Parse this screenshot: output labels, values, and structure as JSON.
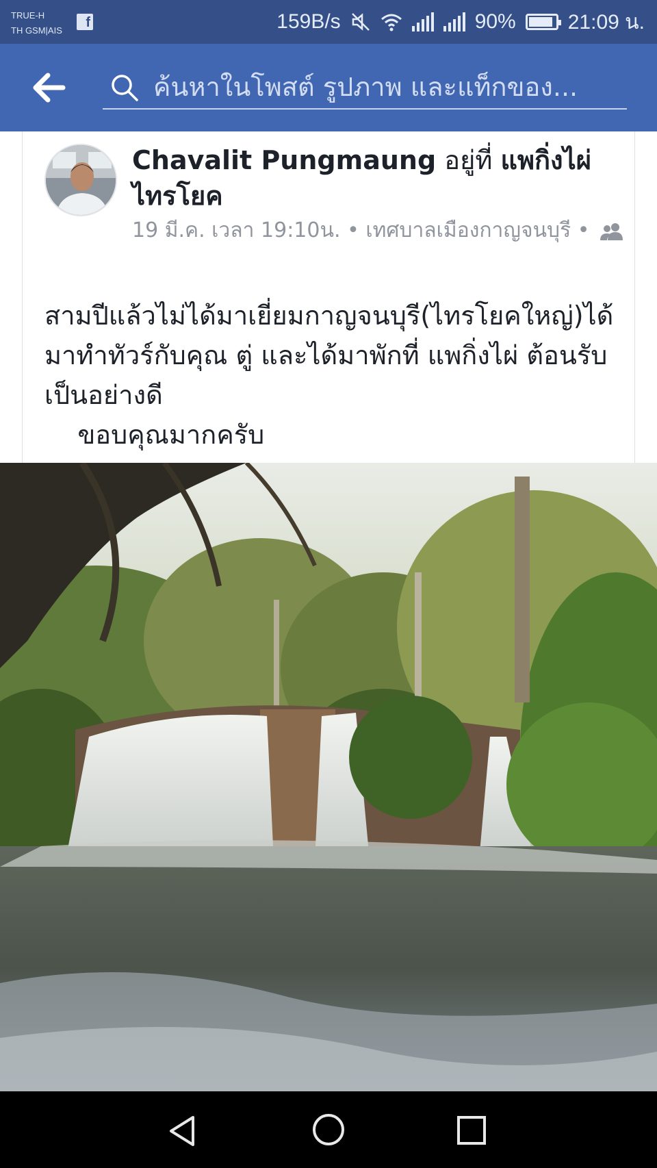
{
  "status_bar": {
    "carrier_line1": "TRUE-H",
    "carrier_line2": "TH GSM|AIS",
    "net_speed": "159B/s",
    "battery": "90%",
    "battery_level": 0.9,
    "time": "21:09 น."
  },
  "search": {
    "placeholder": "ค้นหาในโพสต์ รูปภาพ และแท็กของ..."
  },
  "post": {
    "author": "Chavalit Pungmaung",
    "at_word": "อยู่ที่",
    "place": "แพกิ่งไผ่ไทรโยค",
    "date": "19 มี.ค. เวลา 19:10น.",
    "separator": "•",
    "location": "เทศบาลเมืองกาญจนบุรี",
    "audience_icon": "friends-icon",
    "body": "สามปีแล้วไม่ได้มาเยี่ยมกาญจนบุรี(ไทรโยคใหญ่)ได้มาทำทัวร์กับคุณ ตู่ และได้มาพักที่ แพกิ่งไผ่ ต้อนรับเป็นอย่างดี\n    ขอบคุณมากครับ"
  },
  "photo": {
    "subject": "waterfall-photo"
  },
  "nav": {
    "back_icon": "back-triangle-icon",
    "home_icon": "home-circle-icon",
    "recent_icon": "recent-apps-icon"
  }
}
